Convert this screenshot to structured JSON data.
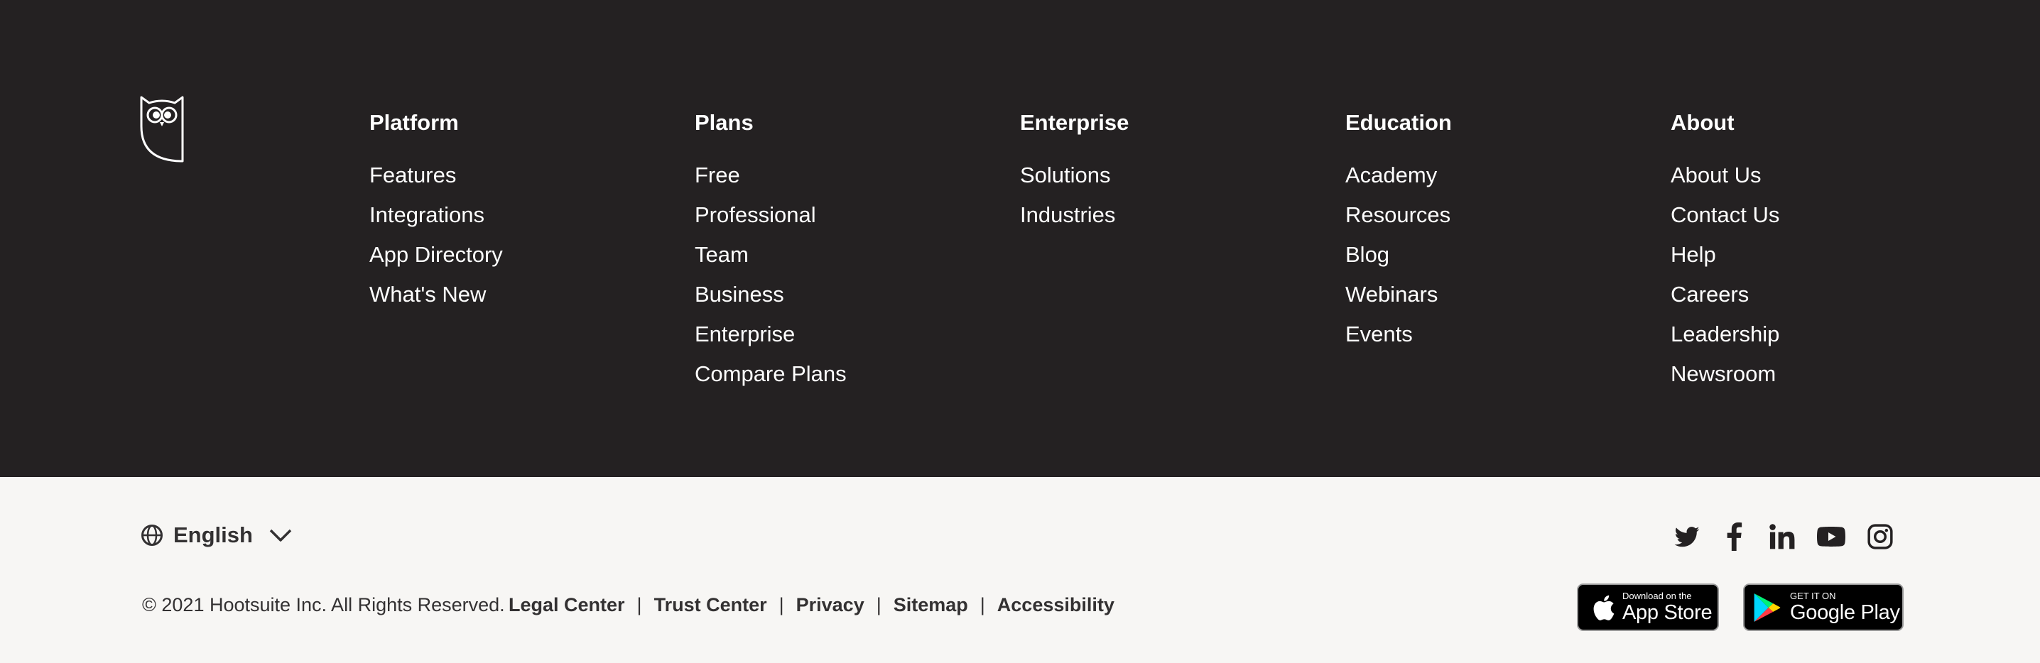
{
  "footer": {
    "columns": [
      {
        "heading": "Platform",
        "links": [
          "Features",
          "Integrations",
          "App Directory",
          "What's New"
        ]
      },
      {
        "heading": "Plans",
        "links": [
          "Free",
          "Professional",
          "Team",
          "Business",
          "Enterprise",
          "Compare Plans"
        ]
      },
      {
        "heading": "Enterprise",
        "links": [
          "Solutions",
          "Industries"
        ]
      },
      {
        "heading": "Education",
        "links": [
          "Academy",
          "Resources",
          "Blog",
          "Webinars",
          "Events"
        ]
      },
      {
        "heading": "About",
        "links": [
          "About Us",
          "Contact Us",
          "Help",
          "Careers",
          "Leadership",
          "Newsroom"
        ]
      }
    ],
    "colors": {
      "dark_bg": "#242122",
      "light_bg": "#f7f6f4",
      "text_dark": "#333132"
    }
  },
  "bottom": {
    "language": "English",
    "copyright": "© 2021 Hootsuite Inc. All Rights Reserved.",
    "legal_links": [
      "Legal Center",
      "Trust Center",
      "Privacy",
      "Sitemap",
      "Accessibility"
    ],
    "separator": "|",
    "social_icons": [
      "twitter-icon",
      "facebook-icon",
      "linkedin-icon",
      "youtube-icon",
      "instagram-icon"
    ],
    "app_store": {
      "small": "Download on the",
      "big": "App Store"
    },
    "google_play": {
      "small": "GET IT ON",
      "big": "Google Play"
    }
  }
}
